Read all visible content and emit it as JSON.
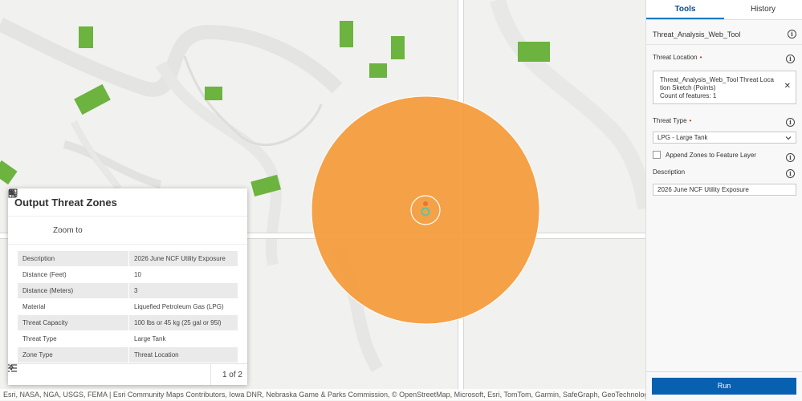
{
  "map": {
    "attribution": "Esri, NASA, NGA, USGS, FEMA | Esri Community Maps Contributors, Iowa DNR, Nebraska Game & Parks Commission, © OpenStreetMap, Microsoft, Esri, TomTom, Garmin, SafeGraph, GeoTechnologies, Inc, METI/NASA, USGS, E",
    "colors": {
      "buffer": "#f59a38",
      "building": "#6cb33f",
      "road": "#ffffff",
      "marker_outer": "#e8762e",
      "marker_inner": "#5cc5a4"
    }
  },
  "popup": {
    "title": "Output Threat Zones",
    "zoom_label": "Zoom to",
    "rows": [
      {
        "key": "Description",
        "value": "2026 June NCF Utility Exposure"
      },
      {
        "key": "Distance (Feet)",
        "value": "10"
      },
      {
        "key": "Distance (Meters)",
        "value": "3"
      },
      {
        "key": "Material",
        "value": "Liquefied Petroleum Gas (LPG)"
      },
      {
        "key": "Threat Capacity",
        "value": "100 lbs or 45 kg (25 gal or 95l)"
      },
      {
        "key": "Threat Type",
        "value": "Large Tank"
      },
      {
        "key": "Zone Type",
        "value": "Threat Location"
      }
    ],
    "pager": "1 of 2"
  },
  "panel": {
    "tabs": [
      "Tools",
      "History"
    ],
    "tool_title": "Threat_Analysis_Web_Tool",
    "threat_location_label": "Threat Location",
    "threat_location_line1": "Threat_Analysis_Web_Tool Threat Loca",
    "threat_location_line2": "tion Sketch (Points)",
    "threat_location_line3": "Count of features: 1",
    "threat_type_label": "Threat Type",
    "threat_type_value": "LPG - Large Tank",
    "append_label": "Append Zones to Feature Layer",
    "description_label": "Description",
    "description_value": "2026 June NCF Utility Exposure",
    "run_label": "Run"
  }
}
